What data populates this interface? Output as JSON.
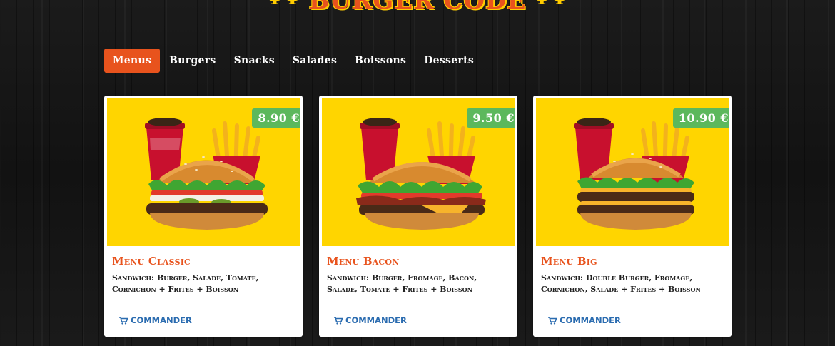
{
  "brand": {
    "name": "BURGER CODE",
    "left_icon": "fork-knife-icon",
    "right_icon": "fork-knife-icon",
    "color": "#e8531d",
    "accent": "#ffcc00"
  },
  "tabs": [
    {
      "label": "Menus",
      "active": true
    },
    {
      "label": "Burgers",
      "active": false
    },
    {
      "label": "Snacks",
      "active": false
    },
    {
      "label": "Salades",
      "active": false
    },
    {
      "label": "Boissons",
      "active": false
    },
    {
      "label": "Desserts",
      "active": false
    }
  ],
  "products": [
    {
      "name": "Menu Classic",
      "price": "8.90 €",
      "description": "Sandwich: Burger, Salade, Tomate, Cornichon + Frites + Boisson",
      "order_label": "COMMANDER",
      "order_icon": "cart-icon"
    },
    {
      "name": "Menu Bacon",
      "price": "9.50 €",
      "description": "Sandwich: Burger, Fromage, Bacon, Salade, Tomate + Frites + Boisson",
      "order_label": "COMMANDER",
      "order_icon": "cart-icon"
    },
    {
      "name": "Menu Big",
      "price": "10.90 €",
      "description": "Sandwich: Double Burger, Fromage, Cornichon, Salade + Frites + Boisson",
      "order_label": "COMMANDER",
      "order_icon": "cart-icon"
    }
  ],
  "colors": {
    "active_tab": "#e8531d",
    "price_badge": "#5cb85c",
    "photo_bg": "#ffd500",
    "order_link": "#2b6cb0"
  }
}
